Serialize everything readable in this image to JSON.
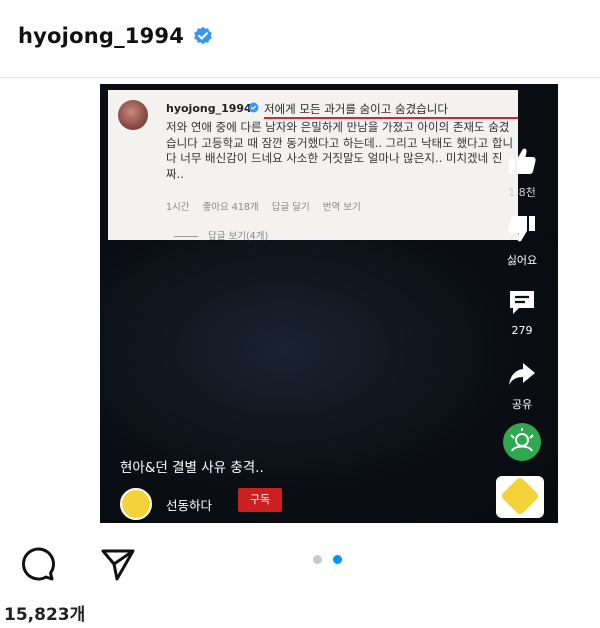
{
  "header": {
    "username": "hyojong_1994"
  },
  "post": {
    "comment": {
      "username": "hyojong_1994",
      "highlight_text": "저에게 모든 과거를 숨이고 숨겼습니다",
      "body": "저와 연애 중에 다른 남자와 은밀하게 만남을 가졌고 아이의 존재도 숨겼습니다 고등학교 때 잠깐 동거했다고 하는데.. 그리고 낙태도 했다고 합니다 너무 배신감이 드네요 사소한 거짓말도 얼마나 많은지.. 미치겠네 진짜..",
      "meta": {
        "time": "1시간",
        "likes": "좋아요 418개",
        "reply": "답글 달기",
        "translate": "번역 보기"
      },
      "replies": "답글 보기(4개)"
    },
    "rail": {
      "like_count": "1.8천",
      "dislike_label": "싫어요",
      "comment_count": "279",
      "share_label": "공유"
    },
    "caption": "현아&던 결별 사유 충격..",
    "channel": {
      "name": "선동하다",
      "subscribe": "구독"
    }
  },
  "footer": {
    "likes": "15,823개"
  },
  "colors": {
    "verified": "#3897f0",
    "underline": "#d8262c",
    "subscribe": "#cc1f1f",
    "remix": "#2fa84f",
    "dot_active": "#0095f6",
    "dot_inactive": "#c8c8c8"
  }
}
